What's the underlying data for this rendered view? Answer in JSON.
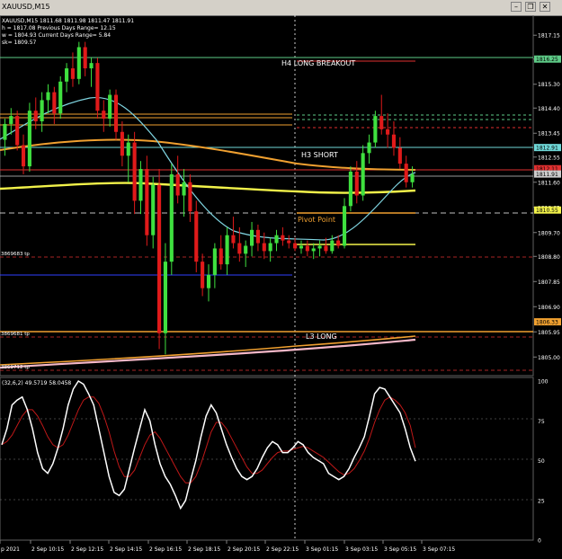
{
  "window": {
    "title": "XAUUSD,M15",
    "minimize_glyph": "–",
    "restore_glyph": "❐",
    "close_glyph": "✕"
  },
  "info": {
    "line1": "XAUUSD,M15  1811.68 1811.98 1811.47 1811.91",
    "line2": "h = 1817.08    Previous Days Range= 12.15",
    "line3": "w = 1804.93    Current Days Range= 5.84",
    "line4": "sk= 1809.57"
  },
  "colors": {
    "background": "#000000",
    "bull": "#3fe03f",
    "bear": "#e01a1a",
    "ma_fast": "#7fd4e0",
    "ma_mid": "#f0a030",
    "ma_slow": "#f2f24a",
    "ma_long": "#f5b8c8",
    "level_cyan": "#6fd8d8",
    "level_green": "#5ecb87",
    "level_red": "#e03030",
    "stoch_main": "#ffffff",
    "stoch_signal": "#c01818"
  },
  "labels": {
    "h4_long_breakout": "H4 LONG BREAKOUT",
    "h3_short": "H3 SHORT",
    "pivot_point": "Pivot Point",
    "l3_long": "L3 LONG",
    "tp1": "3869683 tp",
    "tp2": "3869681 tp",
    "tp3": "3869712 tp"
  },
  "price_axis": {
    "ticks": [
      "1817.15",
      "1816.25",
      "1815.30",
      "1814.40",
      "1813.45",
      "1812.55",
      "1811.60",
      "1810.65",
      "1809.70",
      "1808.80",
      "1807.85",
      "1806.90",
      "1805.95",
      "1805.00"
    ],
    "badges": [
      {
        "text": "1816.25",
        "color": "#5ecb87"
      },
      {
        "text": "1812.91",
        "color": "#6fd8d8"
      },
      {
        "text": "1812.11",
        "color": "#e03030"
      },
      {
        "text": "1811.91",
        "color": "#cccccc"
      },
      {
        "text": "1810.55",
        "color": "#f2f24a"
      },
      {
        "text": "1806.33",
        "color": "#f0a030"
      }
    ],
    "min": 1804.5,
    "max": 1817.7
  },
  "stoch": {
    "label": "(32,6,2) 49.5719 58.0458",
    "ticks": [
      "100",
      "75",
      "50",
      "25",
      "0"
    ],
    "main": [
      60,
      70,
      85,
      88,
      90,
      82,
      70,
      55,
      45,
      42,
      48,
      58,
      70,
      85,
      95,
      100,
      98,
      92,
      85,
      70,
      55,
      40,
      30,
      28,
      32,
      45,
      58,
      70,
      82,
      75,
      60,
      48,
      40,
      35,
      28,
      20,
      25,
      38,
      50,
      65,
      78,
      85,
      80,
      70,
      60,
      52,
      45,
      40,
      38,
      40,
      45,
      52,
      58,
      62,
      60,
      55,
      55,
      58,
      62,
      60,
      55,
      52,
      50,
      48,
      42,
      40,
      38,
      40,
      45,
      52,
      58,
      65,
      78,
      92,
      96,
      95,
      90,
      85,
      80,
      70,
      58,
      49.6
    ],
    "signal": [
      60,
      62,
      66,
      72,
      78,
      82,
      82,
      78,
      72,
      65,
      60,
      58,
      60,
      66,
      74,
      82,
      88,
      90,
      90,
      86,
      78,
      68,
      56,
      46,
      40,
      40,
      44,
      52,
      60,
      66,
      68,
      64,
      58,
      52,
      46,
      40,
      36,
      36,
      40,
      48,
      58,
      68,
      74,
      74,
      70,
      64,
      58,
      52,
      46,
      42,
      42,
      44,
      48,
      52,
      55,
      56,
      56,
      57,
      58,
      59,
      58,
      56,
      54,
      52,
      49,
      46,
      43,
      41,
      42,
      45,
      50,
      56,
      64,
      74,
      82,
      88,
      90,
      88,
      85,
      80,
      72,
      58
    ]
  },
  "time_axis": {
    "labels": [
      "p 2021",
      "2 Sep 10:15",
      "2 Sep 12:15",
      "2 Sep 14:15",
      "2 Sep 16:15",
      "2 Sep 18:15",
      "2 Sep 20:15",
      "2 Sep 22:15",
      "3 Sep 01:15",
      "3 Sep 03:15",
      "3 Sep 05:15",
      "3 Sep 07:15"
    ]
  },
  "chart_data": {
    "type": "candlestick",
    "candles": [
      [
        1813.2,
        1814.0,
        1812.6,
        1813.8
      ],
      [
        1813.8,
        1814.4,
        1813.4,
        1814.1
      ],
      [
        1814.1,
        1814.3,
        1812.8,
        1813.0
      ],
      [
        1813.0,
        1813.4,
        1811.9,
        1812.2
      ],
      [
        1812.2,
        1814.6,
        1812.0,
        1814.3
      ],
      [
        1814.3,
        1814.8,
        1813.6,
        1813.9
      ],
      [
        1813.9,
        1815.0,
        1813.5,
        1814.7
      ],
      [
        1814.7,
        1815.3,
        1814.2,
        1815.0
      ],
      [
        1815.0,
        1815.2,
        1813.8,
        1814.2
      ],
      [
        1814.2,
        1815.6,
        1814.0,
        1815.4
      ],
      [
        1815.4,
        1816.1,
        1815.0,
        1815.9
      ],
      [
        1815.9,
        1816.5,
        1815.2,
        1815.5
      ],
      [
        1815.5,
        1816.9,
        1815.3,
        1816.7
      ],
      [
        1816.7,
        1816.9,
        1815.6,
        1815.9
      ],
      [
        1815.9,
        1816.3,
        1815.2,
        1816.1
      ],
      [
        1816.1,
        1816.3,
        1814.0,
        1814.3
      ],
      [
        1814.3,
        1814.7,
        1813.5,
        1814.0
      ],
      [
        1814.0,
        1815.1,
        1813.7,
        1814.9
      ],
      [
        1814.9,
        1815.1,
        1813.2,
        1813.5
      ],
      [
        1813.5,
        1813.9,
        1812.2,
        1812.6
      ],
      [
        1812.6,
        1813.4,
        1811.6,
        1813.1
      ],
      [
        1813.1,
        1813.5,
        1810.4,
        1810.9
      ],
      [
        1810.9,
        1812.4,
        1810.4,
        1812.1
      ],
      [
        1812.1,
        1812.6,
        1809.2,
        1809.6
      ],
      [
        1809.6,
        1811.8,
        1809.1,
        1811.5
      ],
      [
        1811.5,
        1812.1,
        1805.3,
        1805.9
      ],
      [
        1805.9,
        1809.3,
        1805.1,
        1808.6
      ],
      [
        1808.6,
        1812.3,
        1808.1,
        1811.9
      ],
      [
        1811.9,
        1812.6,
        1810.8,
        1811.1
      ],
      [
        1811.1,
        1812.1,
        1810.3,
        1811.6
      ],
      [
        1811.6,
        1811.9,
        1810.1,
        1810.5
      ],
      [
        1810.5,
        1810.9,
        1808.2,
        1808.6
      ],
      [
        1808.6,
        1808.9,
        1807.3,
        1807.6
      ],
      [
        1807.6,
        1808.5,
        1807.1,
        1808.1
      ],
      [
        1808.1,
        1809.3,
        1807.6,
        1809.1
      ],
      [
        1809.1,
        1809.6,
        1808.3,
        1808.5
      ],
      [
        1808.5,
        1809.9,
        1808.1,
        1809.6
      ],
      [
        1809.6,
        1810.3,
        1809.1,
        1809.3
      ],
      [
        1809.3,
        1809.9,
        1808.6,
        1808.9
      ],
      [
        1808.9,
        1809.4,
        1808.4,
        1809.2
      ],
      [
        1809.2,
        1810.1,
        1808.8,
        1809.8
      ],
      [
        1809.8,
        1810.0,
        1809.0,
        1809.3
      ],
      [
        1809.3,
        1809.7,
        1808.7,
        1809.0
      ],
      [
        1809.0,
        1809.5,
        1808.6,
        1809.3
      ],
      [
        1809.3,
        1809.8,
        1809.0,
        1809.6
      ],
      [
        1809.6,
        1809.9,
        1809.2,
        1809.4
      ],
      [
        1809.4,
        1809.6,
        1809.1,
        1809.3
      ],
      [
        1809.3,
        1809.5,
        1809.0,
        1809.1
      ],
      [
        1809.1,
        1809.4,
        1808.9,
        1809.2
      ],
      [
        1809.2,
        1809.4,
        1808.8,
        1809.0
      ],
      [
        1809.0,
        1809.3,
        1808.7,
        1809.1
      ],
      [
        1809.1,
        1809.4,
        1808.8,
        1809.2
      ],
      [
        1809.2,
        1809.5,
        1808.9,
        1809.0
      ],
      [
        1809.0,
        1809.6,
        1808.9,
        1809.4
      ],
      [
        1809.4,
        1809.6,
        1809.1,
        1809.2
      ],
      [
        1809.2,
        1811.0,
        1809.1,
        1810.7
      ],
      [
        1810.7,
        1812.2,
        1810.5,
        1812.0
      ],
      [
        1812.0,
        1812.4,
        1810.8,
        1811.1
      ],
      [
        1811.1,
        1813.0,
        1810.9,
        1812.7
      ],
      [
        1812.7,
        1813.4,
        1812.3,
        1813.1
      ],
      [
        1813.1,
        1814.3,
        1812.9,
        1814.1
      ],
      [
        1814.1,
        1814.9,
        1813.4,
        1813.6
      ],
      [
        1813.6,
        1814.2,
        1812.9,
        1813.4
      ],
      [
        1813.4,
        1813.9,
        1812.6,
        1812.9
      ],
      [
        1812.9,
        1813.3,
        1812.1,
        1812.3
      ],
      [
        1812.3,
        1812.6,
        1811.4,
        1811.6
      ],
      [
        1811.6,
        1812.2,
        1811.4,
        1811.9
      ]
    ],
    "ylim": [
      1804.5,
      1817.7
    ]
  }
}
